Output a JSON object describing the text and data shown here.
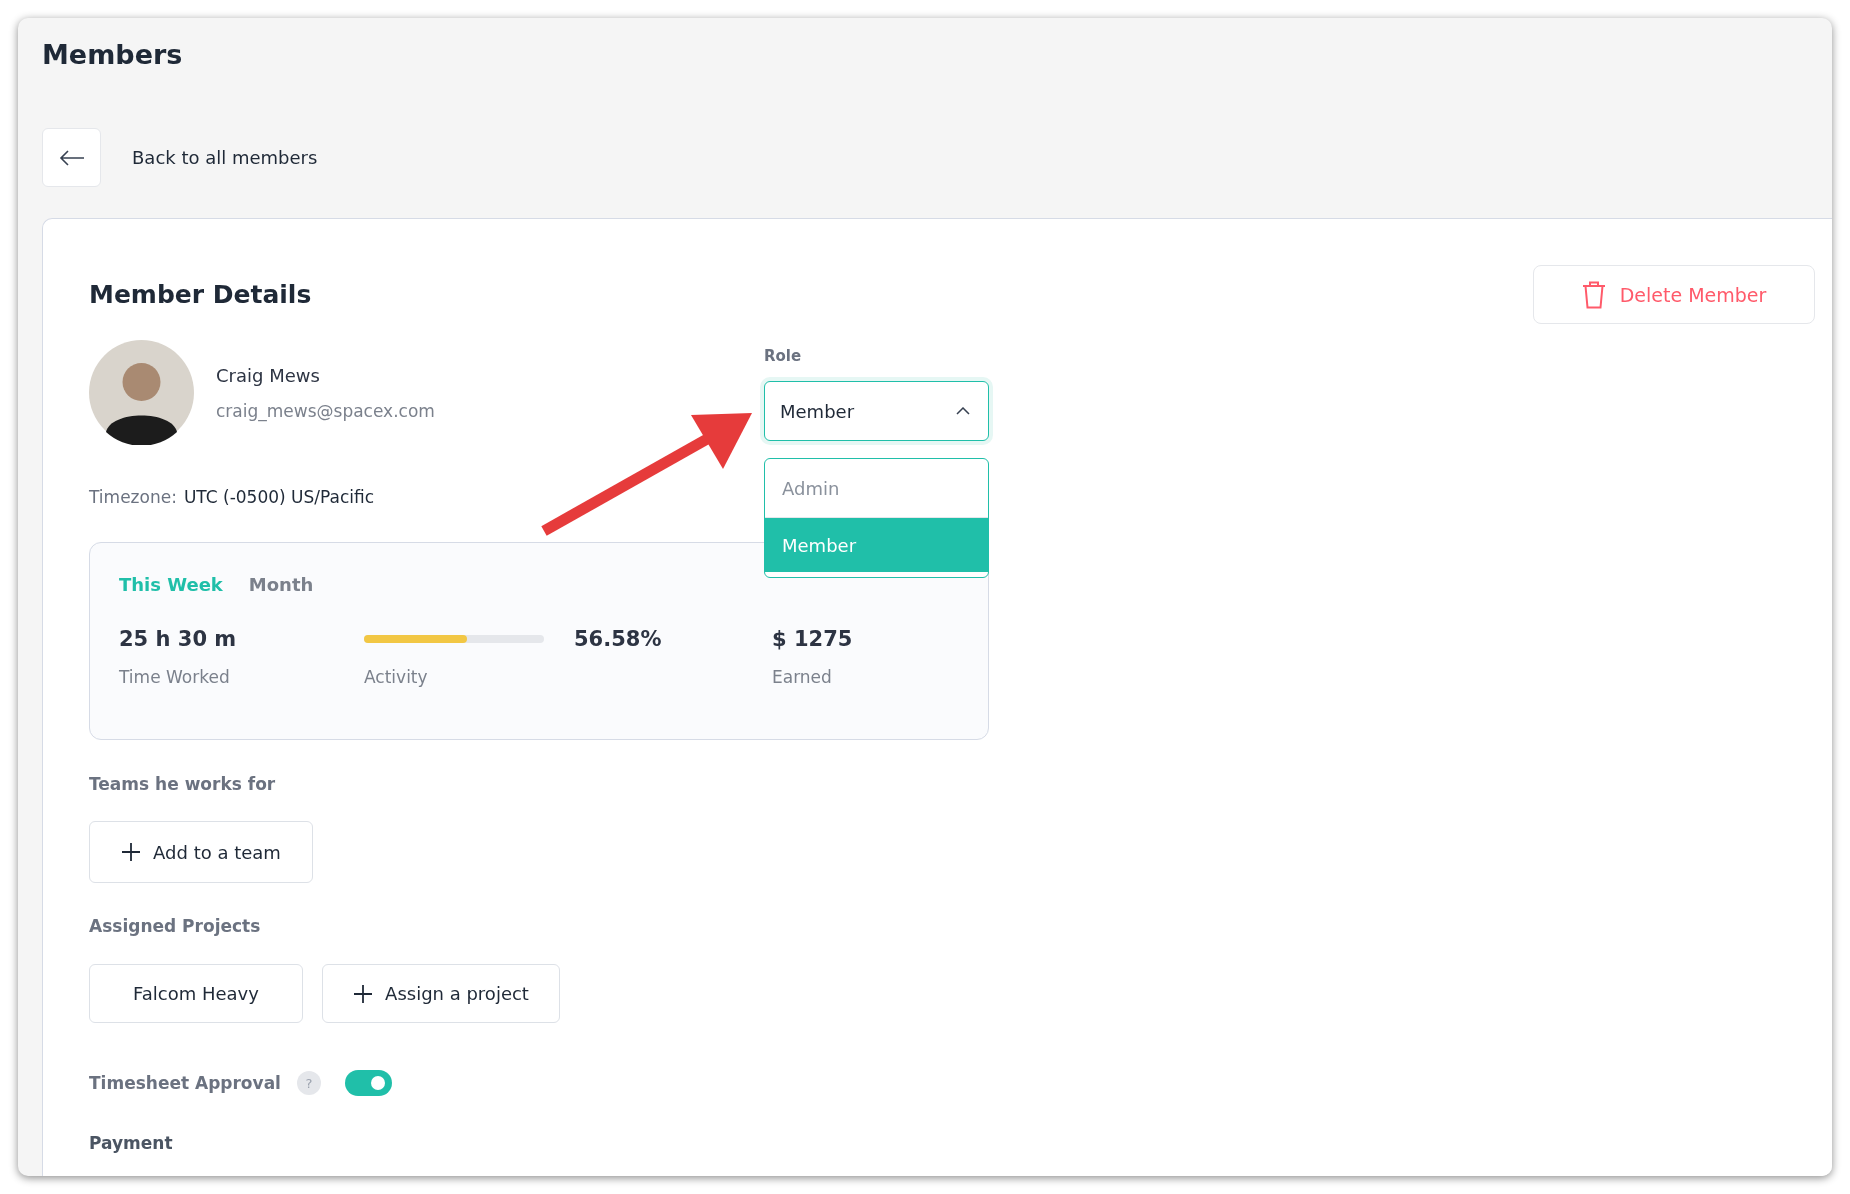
{
  "page": {
    "title": "Members"
  },
  "back_link": {
    "label": "Back to all members"
  },
  "details": {
    "title": "Member Details",
    "delete_button": "Delete Member",
    "member": {
      "name": "Craig Mews",
      "email": "craig_mews@spacex.com"
    },
    "timezone": {
      "label": "Timezone:",
      "value": "UTC (-0500) US/Pacific"
    },
    "role": {
      "label": "Role",
      "value": "Member",
      "expanded": true,
      "options": [
        {
          "label": "Admin",
          "selected": false
        },
        {
          "label": "Member",
          "selected": true
        }
      ]
    },
    "stats": {
      "tabs": [
        {
          "label": "This Week",
          "selected": true
        },
        {
          "label": "Month",
          "selected": false
        }
      ],
      "time_worked": {
        "value": "25 h 30 m",
        "label": "Time Worked"
      },
      "activity": {
        "level": 0.57,
        "value": "56.58%",
        "label": "Activity"
      },
      "earned": {
        "value": "$ 1275",
        "label": "Earned"
      }
    },
    "teams": {
      "label": "Teams he works for",
      "add_button": "Add to a team"
    },
    "projects": {
      "label": "Assigned Projects",
      "items": [
        "Falcom Heavy"
      ],
      "assign_button": "Assign a project"
    },
    "timesheet_approval": {
      "label": "Timesheet Approval",
      "help": "?",
      "on": true
    },
    "payment": {
      "label": "Payment"
    }
  }
}
